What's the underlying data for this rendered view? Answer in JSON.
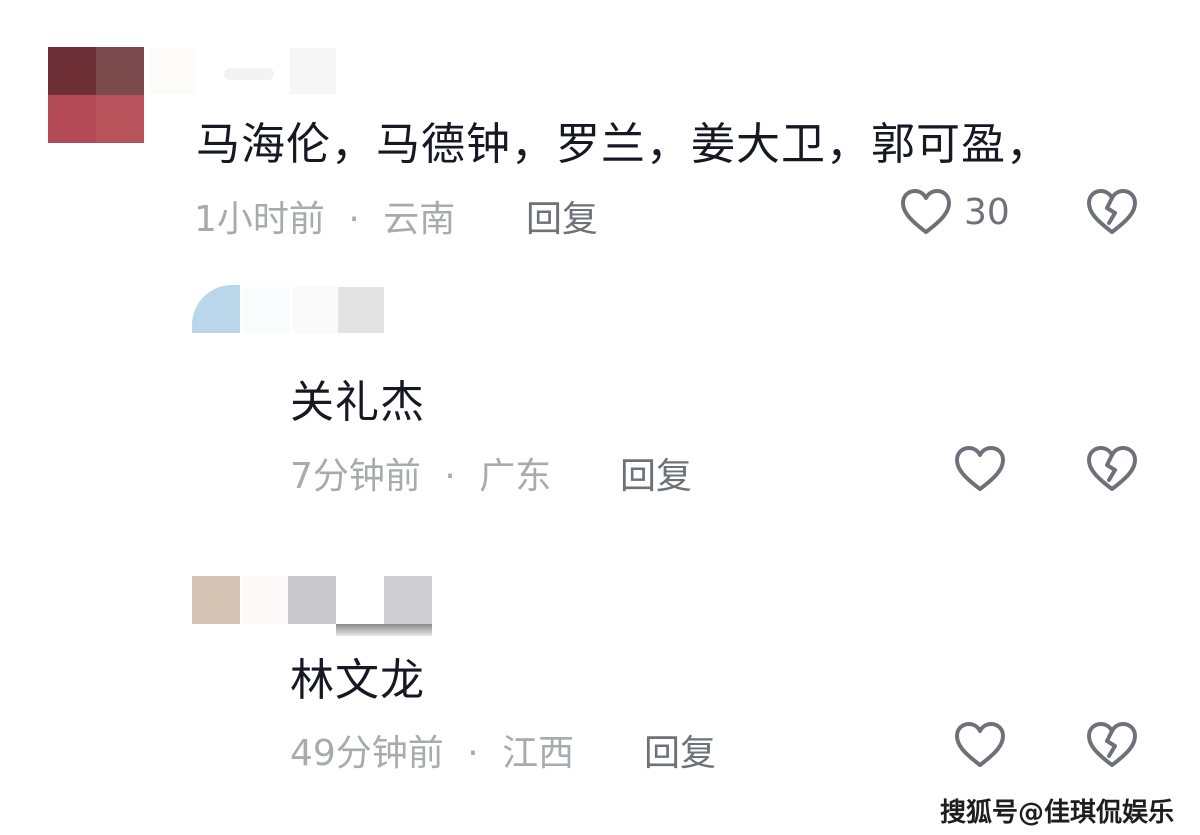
{
  "comments": [
    {
      "text": "马海伦，马德钟，罗兰，姜大卫，郭可盈，",
      "time": "1小时前",
      "location": "云南",
      "reply_label": "回复",
      "like_count": "30"
    },
    {
      "text": "关礼杰",
      "time": "7分钟前",
      "location": "广东",
      "reply_label": "回复"
    },
    {
      "text": "林文龙",
      "time": "49分钟前",
      "location": "江西",
      "reply_label": "回复"
    }
  ],
  "separator": "·",
  "icons": {
    "like": "heart-outline-icon",
    "dislike": "broken-heart-icon"
  },
  "watermark": "搜狐号@佳琪侃娱乐",
  "colors": {
    "text_primary": "#161823",
    "text_meta": "#a9aab0",
    "text_reply": "#6f7079",
    "icon_stroke": "#6f7079"
  }
}
